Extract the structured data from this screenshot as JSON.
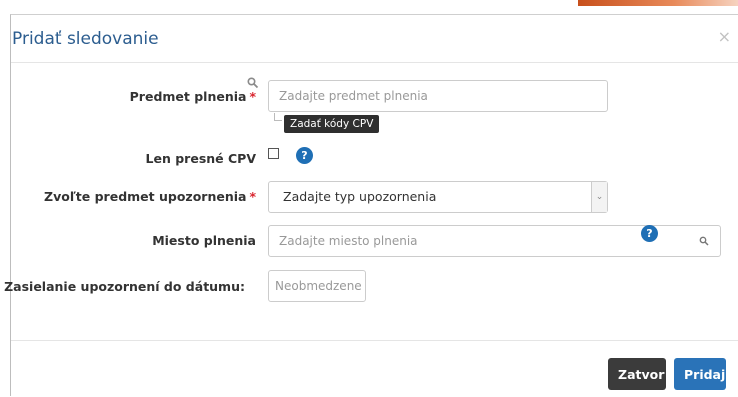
{
  "dialog": {
    "title": "Pridať sledovanie",
    "close_symbol": "×"
  },
  "form": {
    "subject": {
      "label": "Predmet plnenia",
      "required_mark": "*",
      "placeholder": "Zadajte predmet plnenia",
      "icon": "magnifier-icon",
      "cpv_tooltip": "Zadať kódy CPV"
    },
    "exact_cpv": {
      "label": "Len presné CPV",
      "checked": false,
      "help": "?"
    },
    "alert_type": {
      "label": "Zvoľte predmet upozornenia",
      "required_mark": "*",
      "selected": "Zadajte typ upozornenia",
      "caret": "⌄"
    },
    "location": {
      "label": "Miesto plnenia",
      "placeholder": "Zadajte miesto plnenia",
      "help": "?",
      "icon": "search-icon"
    },
    "until_date": {
      "label": "Zasielanie upozornení do dátumu:",
      "placeholder": "Neobmedzene"
    }
  },
  "footer": {
    "close_label": "Zatvor",
    "add_label": "Pridaj"
  },
  "colors": {
    "title": "#2c5d8f",
    "required": "#d9262f",
    "help": "#1f6fb5",
    "btn_close": "#3b3b3b",
    "btn_add": "#2a73b8"
  }
}
